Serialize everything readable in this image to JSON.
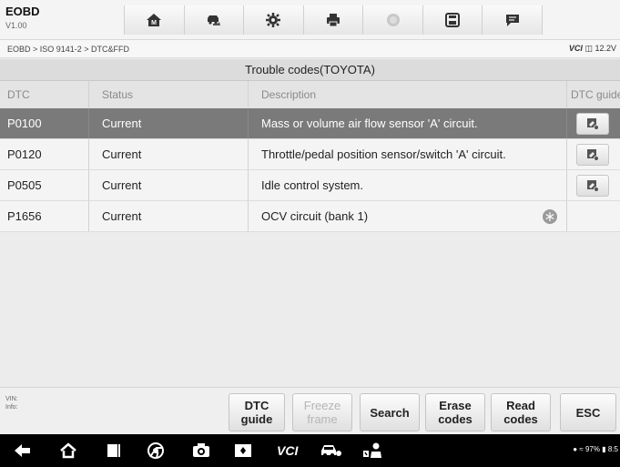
{
  "app": {
    "title": "EOBD",
    "version": "V1.00"
  },
  "toolbar": {
    "items": [
      "home-icon",
      "vehicle-swap-icon",
      "settings-icon",
      "print-icon",
      "help-icon",
      "save-icon",
      "message-icon"
    ]
  },
  "breadcrumb": "EOBD > ISO 9141-2 > DTC&FFD",
  "vci": {
    "label": "VCI",
    "voltage": "12.2V"
  },
  "section_title": "Trouble codes(TOYOTA)",
  "table": {
    "headers": {
      "dtc": "DTC",
      "status": "Status",
      "description": "Description",
      "guide": "DTC guide"
    },
    "rows": [
      {
        "dtc": "P0100",
        "status": "Current",
        "description": "Mass or volume air flow sensor 'A' circuit."
      },
      {
        "dtc": "P0120",
        "status": "Current",
        "description": "Throttle/pedal position sensor/switch 'A' circuit."
      },
      {
        "dtc": "P0505",
        "status": "Current",
        "description": "Idle control system."
      },
      {
        "dtc": "P1656",
        "status": "Current",
        "description": "OCV circuit (bank 1)"
      }
    ]
  },
  "footer": {
    "vin_label": "VIN:",
    "info_label": "Info:",
    "buttons": {
      "dtc_guide": [
        "DTC",
        "guide"
      ],
      "freeze_frame": [
        "Freeze",
        "frame"
      ],
      "search": "Search",
      "erase_codes": [
        "Erase",
        "codes"
      ],
      "read_codes": [
        "Read",
        "codes"
      ],
      "esc": "ESC"
    }
  },
  "navbar": {
    "items": [
      "back-icon",
      "home-icon",
      "recents-icon",
      "chrome-icon",
      "camera-icon",
      "screen-icon",
      "vci-icon",
      "car-icon",
      "mechanic-icon"
    ]
  },
  "status_bar": {
    "battery": "97%",
    "time": "8:5"
  },
  "colors": {
    "selected_row": "#7a7a7a",
    "background": "#ececec",
    "navbar": "#000000"
  }
}
